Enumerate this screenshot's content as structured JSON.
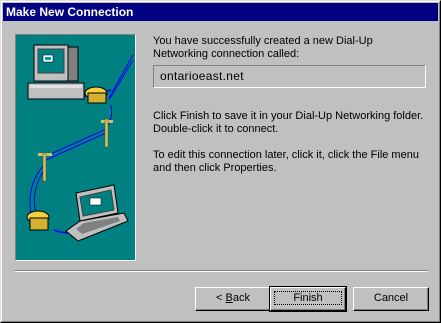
{
  "window": {
    "title": "Make New Connection"
  },
  "main": {
    "intro_text": "You have successfully created a new Dial-Up Networking connection called:",
    "connection_name": "ontarioeast.net",
    "finish_text": "Click Finish to save it in your Dial-Up Networking folder. Double-click it to connect.",
    "edit_text": "To edit this connection later, click it, click the File menu and then click Properties."
  },
  "buttons": {
    "back_prefix": "< ",
    "back_accel": "B",
    "back_rest": "ack",
    "finish": "Finish",
    "cancel": "Cancel"
  },
  "colors": {
    "titlebar": "#000080",
    "face": "#c0c0c0",
    "illustration_bg": "#008080"
  }
}
